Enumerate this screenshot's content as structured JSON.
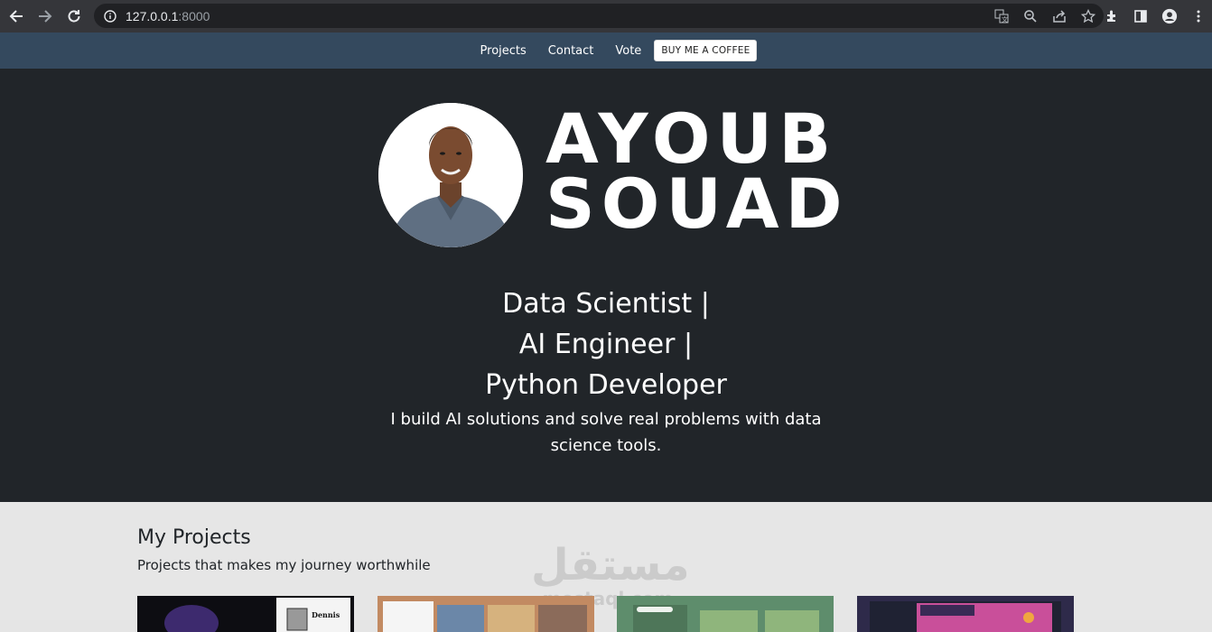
{
  "browser": {
    "url_host": "127.0.0.1",
    "url_port": ":8000"
  },
  "nav": {
    "links": [
      "Projects",
      "Contact",
      "Vote"
    ],
    "coffee_label": "BUY ME A COFFEE"
  },
  "hero": {
    "name_first": "AYOUB",
    "name_last": "SOUAD",
    "roles": [
      "Data Scientist |",
      "AI Engineer |",
      "Python Developer"
    ],
    "tagline": "I build AI solutions and solve real problems with data science tools."
  },
  "projects": {
    "title": "My Projects",
    "subtitle": "Projects that makes my journey worthwhile",
    "card1_text": "Dennis"
  },
  "watermark": {
    "arabic": "مستقل",
    "latin": "mostaql.com"
  },
  "colors": {
    "nav_bg": "#34495e",
    "hero_bg": "#212529",
    "section_bg": "#e6e6e6"
  }
}
